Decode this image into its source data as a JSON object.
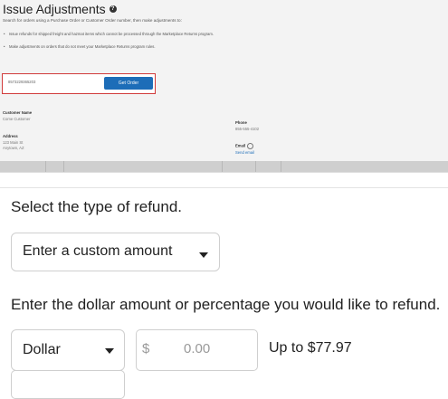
{
  "screenshot": {
    "title": "Issue Adjustments",
    "subtitle": "Search for orders using a Purchase Order or Customer Order number, then make adjustments to:",
    "bullets": [
      "Issue refunds for shipped freight and hazmat items which cannot be processed through the Marketplace Returns program.",
      "Make adjustments on orders that do not meet your Marketplace Returns program rules."
    ],
    "order_number": "8573229365203",
    "get_order_label": "Get Order",
    "customer_name_label": "Customer Name",
    "customer_name": "Come Customer",
    "address_label": "Address",
    "address_line1": "123 Main St",
    "address_line2": "Anytown, AZ",
    "phone_label": "Phone",
    "phone": "855-555-4102",
    "email_label": "Email",
    "send_email": "Send email"
  },
  "refund": {
    "select_heading": "Select the type of refund.",
    "refund_type": "Enter a custom amount",
    "amount_heading": "Enter the dollar amount or percentage you would like to refund.",
    "unit": "Dollar",
    "currency_symbol": "$",
    "amount_placeholder": "0.00",
    "limit_text": "Up to $77.97"
  }
}
